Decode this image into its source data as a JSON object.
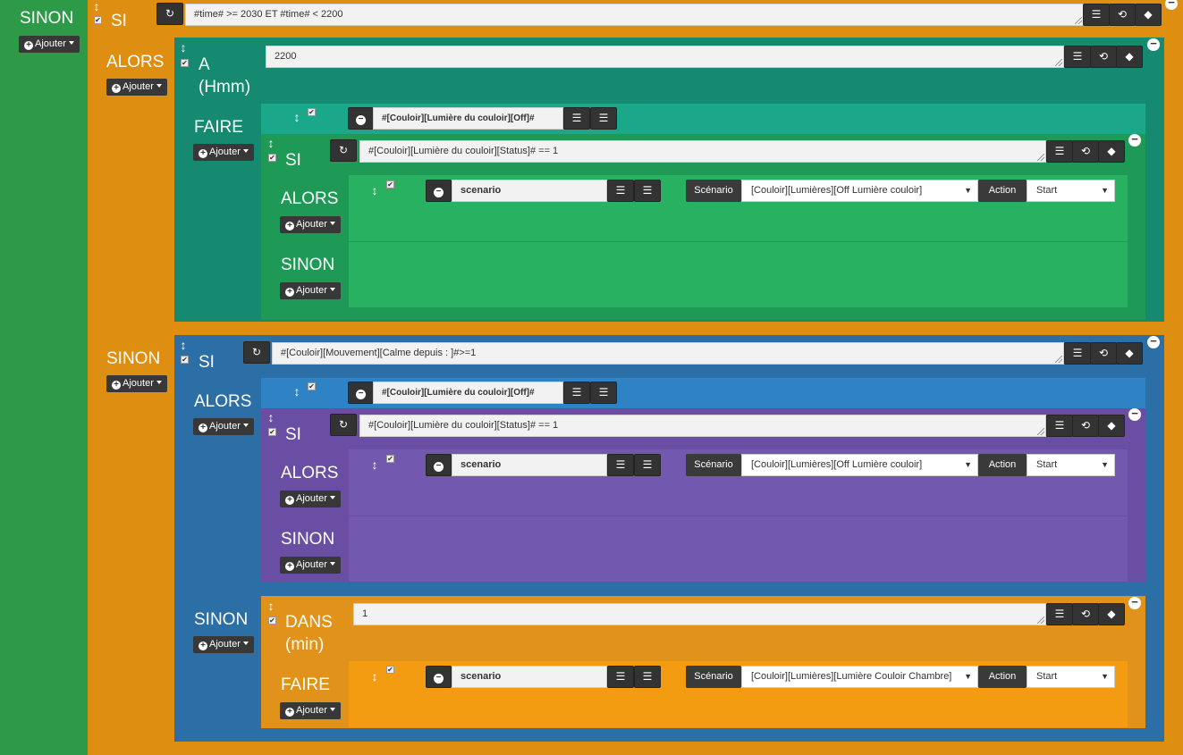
{
  "ui": {
    "add_label": "Ajouter",
    "scenario_label": "Scénario",
    "action_label": "Action",
    "checkbox": "✔",
    "move_icon": "↕",
    "refresh_icon": "↻",
    "minus_icon": "−",
    "caret": "▾"
  },
  "left": {
    "label": "SINON"
  },
  "outer": {
    "si_label": "SI",
    "condition": "#time# >= 2030 ET #time# < 2200",
    "alors_label": "ALORS",
    "sinon_label": "SINON"
  },
  "a_block": {
    "label_line1": "A",
    "label_line2": "(Hmm)",
    "value": "2200",
    "faire_label": "FAIRE",
    "action_cmd": "#[Couloir][Lumière du couloir][Off]#",
    "inner_si": {
      "si_label": "SI",
      "condition": "#[Couloir][Lumière du couloir][Status]# == 1",
      "alors_label": "ALORS",
      "sinon_label": "SINON",
      "action": {
        "name": "scenario",
        "scenario_value": "[Couloir][Lumières][Off Lumière couloir]",
        "action_value": "Start"
      }
    }
  },
  "si_block": {
    "si_label": "SI",
    "condition": "#[Couloir][Mouvement][Calme depuis : ]#>=1",
    "alors_label": "ALORS",
    "sinon_label": "SINON",
    "action_cmd": "#[Couloir][Lumière du couloir][Off]#",
    "inner_si": {
      "si_label": "SI",
      "condition": "#[Couloir][Lumière du couloir][Status]# == 1",
      "alors_label": "ALORS",
      "sinon_label": "SINON",
      "action": {
        "name": "scenario",
        "scenario_value": "[Couloir][Lumières][Off Lumière couloir]",
        "action_value": "Start"
      }
    },
    "dans": {
      "label_line1": "DANS",
      "label_line2": "(min)",
      "value": "1",
      "faire_label": "FAIRE",
      "action": {
        "name": "scenario",
        "scenario_value": "[Couloir][Lumières][Lumière Couloir Chambre]",
        "action_value": "Start"
      }
    }
  },
  "colors": {
    "green": "#2d9a47",
    "orange": "#de8e10",
    "teal": "#168a70",
    "blue": "#2c6ea6",
    "purple": "#7358b0",
    "bright_green": "#27b160",
    "bright_orange": "#f39c12"
  }
}
